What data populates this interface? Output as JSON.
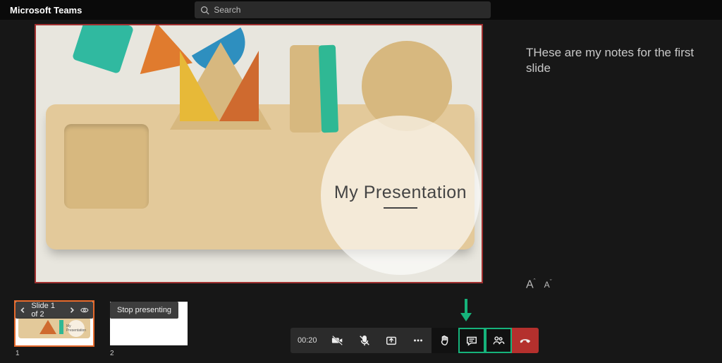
{
  "header": {
    "app_title": "Microsoft Teams",
    "search_placeholder": "Search"
  },
  "presentation": {
    "title": "My Presentation",
    "notes_text": "THese are my notes for the first slide"
  },
  "font_controls": {
    "increase_label": "A",
    "decrease_label": "A"
  },
  "slide_nav": {
    "counter_label": "Slide 1 of 2"
  },
  "thumbnails": [
    {
      "index_label": "1",
      "mini_title": "My Presentation",
      "active": true
    },
    {
      "index_label": "2",
      "mini_title": "",
      "active": false
    }
  ],
  "controls": {
    "stop_presenting_label": "Stop presenting"
  },
  "call": {
    "timer": "00:20",
    "hangup_color": "#b4302d",
    "highlight_color": "#16b37b"
  },
  "colors": {
    "slide_border": "#a03030",
    "thumb_active": "#e66a2c"
  }
}
